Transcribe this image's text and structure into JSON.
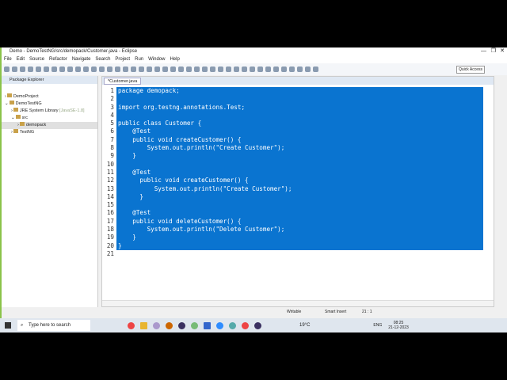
{
  "window": {
    "title": "Demo - DemoTestNG/src/demopack/Customer.java - Eclipse",
    "controls": [
      "—",
      "❐",
      "✕"
    ]
  },
  "menu": [
    "File",
    "Edit",
    "Source",
    "Refactor",
    "Navigate",
    "Search",
    "Project",
    "Run",
    "Window",
    "Help"
  ],
  "toolbar": {
    "quick_access": "Quick Access"
  },
  "package_explorer": {
    "title": "Package Explorer",
    "items": [
      {
        "label": "DemoProject",
        "depth": 0,
        "arrow": "›"
      },
      {
        "label": "DemoTestNG",
        "depth": 0,
        "arrow": "⌄"
      },
      {
        "label": "JRE System Library",
        "extra": "[JavaSE-1.8]",
        "depth": 1,
        "arrow": "›"
      },
      {
        "label": "src",
        "depth": 1,
        "arrow": "⌄"
      },
      {
        "label": "demopack",
        "depth": 2,
        "arrow": "›"
      },
      {
        "label": "TestNG",
        "depth": 1,
        "arrow": "›"
      }
    ]
  },
  "editor": {
    "tab": "*Customer.java",
    "lines": [
      "package demopack;",
      "",
      "import org.testng.annotations.Test;",
      "",
      "public class Customer {",
      "    @Test",
      "    public void createCustomer() {",
      "        System.out.println(\"Create Customer\");",
      "    }",
      "",
      "    @Test",
      "      public void createCustomer() {",
      "          System.out.println(\"Create Customer\");",
      "      }",
      "",
      "    @Test",
      "    public void deleteCustomer() {",
      "        System.out.println(\"Delete Customer\");",
      "    }",
      "}",
      ""
    ]
  },
  "status": {
    "mode": "Writable",
    "insert": "Smart Insert",
    "position": "21 : 1"
  },
  "taskbar": {
    "search_placeholder": "Type here to search",
    "weather": "19°C",
    "lang": "ENG",
    "time": "08:25",
    "date": "21-12-2023"
  },
  "colors": {
    "selection": "#0a74d0"
  }
}
